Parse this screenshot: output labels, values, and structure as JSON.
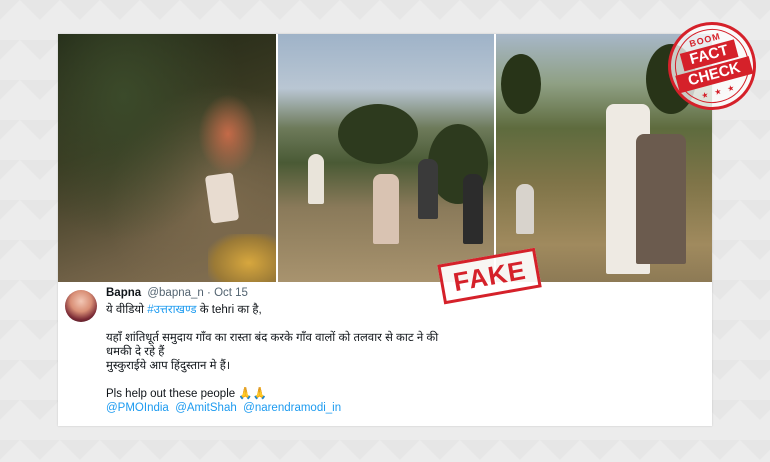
{
  "stamp": {
    "fake_label": "FAKE"
  },
  "badge": {
    "top_label": "BOOM",
    "fact_label": "FACT",
    "check_label": "CHECK",
    "stars": "★ ★ ★"
  },
  "tweet": {
    "display_name": "Bapna",
    "handle": "@bapna_n",
    "separator": "·",
    "date": "Oct 15",
    "line1_pre": "ये वीडियो ",
    "line1_hashtag": "#उत्तराखण्ड",
    "line1_post": " के tehri का है,",
    "line2": "यहाँ शांतिधूर्त  समुदाय  गाँव का रास्ता बंद करके गाँव वालों को तलवार से काट ने की",
    "line3": "धमकी दे रहे हैं",
    "line4": "मुस्कुराईये आप हिंदुस्तान मे हैं।",
    "line5": "Pls help out these people 🙏🙏",
    "mentions": [
      "@PMOIndia",
      "@AmitShah",
      "@narendramodi_in"
    ]
  }
}
